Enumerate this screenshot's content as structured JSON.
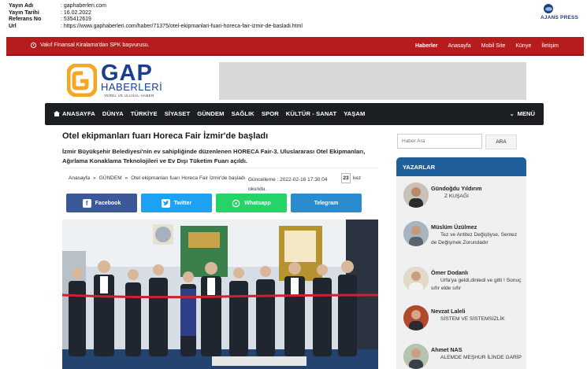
{
  "press": {
    "rows": [
      {
        "key": "Yayın Adı",
        "value": ": gaphaberleri.com"
      },
      {
        "key": "Yayın Tarihi",
        "value": ": 16.02.2022"
      },
      {
        "key": "Referans No",
        "value": ": 535412619"
      },
      {
        "key": "Url",
        "value": ": https://www.gaphaberleri.com/haber/71375/otel-ekipmanlari-fuari-horeca-fair-izmir-de-basladi.html"
      }
    ],
    "agency_name": "AJANS PRESS"
  },
  "topbar": {
    "ticker": "Vakıf Finansal Kiralama'dan SPK başvurusu.",
    "links": [
      "Haberler",
      "Anasayfa",
      "Mobil Site",
      "Künye",
      "İletişim"
    ]
  },
  "logo": {
    "main": "GAP",
    "sub": "HABERLERİ",
    "tagline": "YEREL VE ULUSAL HABER"
  },
  "nav": {
    "items": [
      "ANASAYFA",
      "DÜNYA",
      "TÜRKİYE",
      "SİYASET",
      "GÜNDEM",
      "SAĞLIK",
      "SPOR",
      "KÜLTÜR - SANAT",
      "YAŞAM"
    ],
    "menu": "MENÜ"
  },
  "article": {
    "title": "Otel ekipmanları fuarı Horeca Fair İzmir'de başladı",
    "summary": "İzmir Büyükşehir Belediyesi'nin ev sahipliğinde düzenlenen HORECA Fair-3. Uluslararası Otel Ekipmanları, Ağırlama Konaklama Teknolojileri ve Ev Dışı Tüketim Fuarı açıldı.",
    "breadcrumb": [
      "Anasayfa",
      "GÜNDEM",
      "Otel ekipmanları fuarı Horeca Fair İzmir'de başladı"
    ],
    "updated": "Güncelleme : 2022-02-16 17:30:04 okundu.",
    "read_count": "23",
    "read_suffix": "kez",
    "share": {
      "facebook": "Facebook",
      "twitter": "Twitter",
      "whatsapp": "Whatsapp",
      "telegram": "Telegram"
    }
  },
  "sidebar": {
    "search_placeholder": "Haber Ara",
    "search_button": "ARA",
    "writers_title": "YAZARLAR",
    "writers": [
      {
        "name": "Gündoğdu Yıldırım",
        "title": "Z KUŞAĞI"
      },
      {
        "name": "Müslüm Üzülmez",
        "title": "Tez ve Antitez Değiştiyse, Sentez de Değişmek Zorundadır"
      },
      {
        "name": "Ömer Dodanlı",
        "title": "Urfa'ya geldi,dinledi ve gitti ! Sonuç sıfır elde sıfır"
      },
      {
        "name": "Nevzat Laleli",
        "title": "SİSTEM VE SİSTEMSİZLİK"
      },
      {
        "name": "Ahmet NAS",
        "title": "ALEMDE MEŞHUR İLİNDE GARİP"
      }
    ]
  },
  "colors": {
    "topbar": "#b71c1c",
    "navbar": "#1c1f22",
    "logo_blue": "#1a3f8f",
    "logo_orange": "#f5a623",
    "writers_header": "#1f5f9c",
    "facebook": "#3b5998",
    "twitter": "#1da1f2",
    "whatsapp": "#25d366",
    "telegram": "#2a8ccf"
  }
}
